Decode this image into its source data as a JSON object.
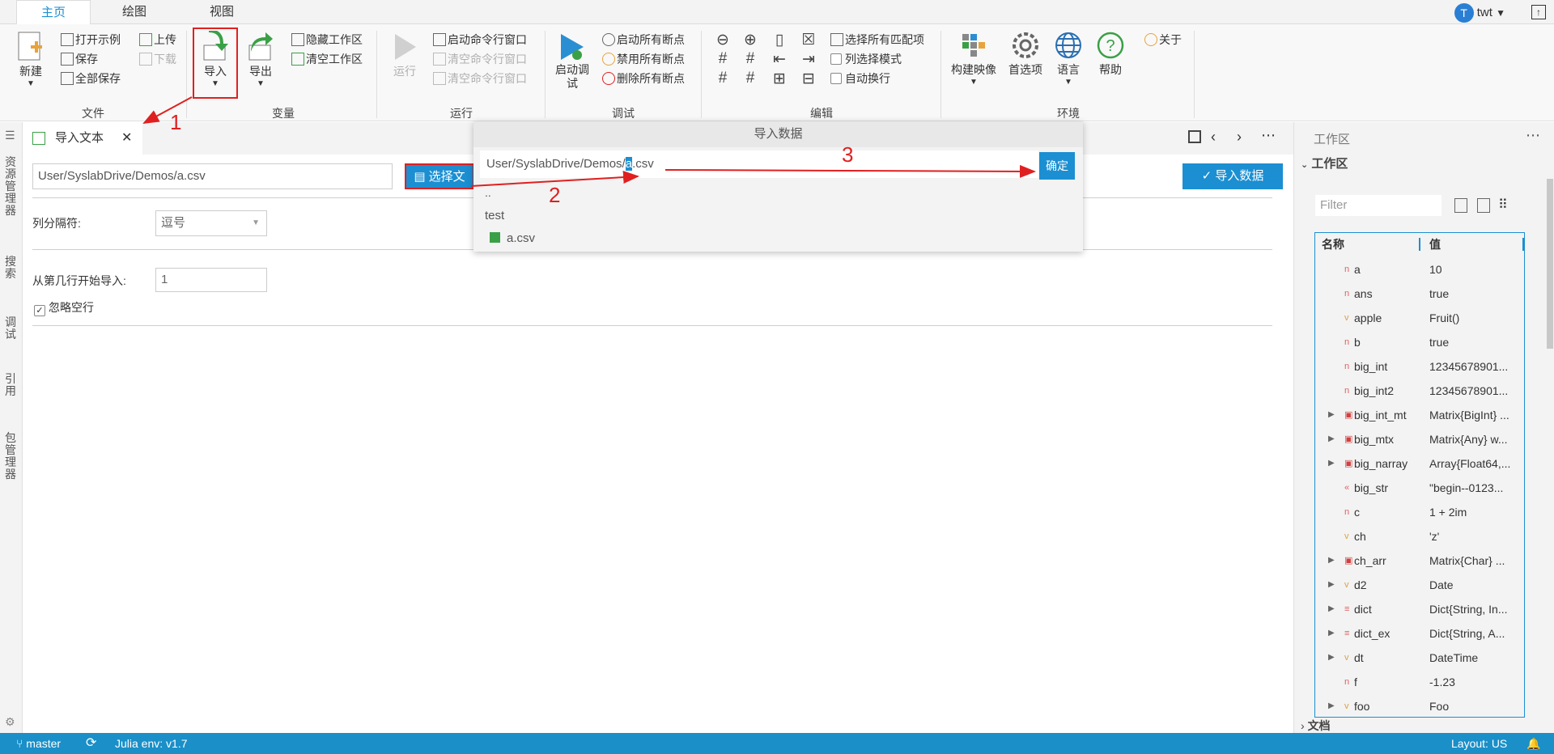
{
  "ribbon_tabs": [
    "主页",
    "绘图",
    "视图"
  ],
  "user": {
    "initial": "T",
    "name": "twt"
  },
  "ribbon": {
    "file": {
      "group": "文件",
      "new": "新建",
      "open_example": "打开示例",
      "save": "保存",
      "save_all": "全部保存",
      "upload": "上传",
      "download": "下载"
    },
    "variable": {
      "group": "变量",
      "import": "导入",
      "export": "导出",
      "hide_workspace": "隐藏工作区",
      "clear_workspace": "清空工作区"
    },
    "run": {
      "group": "运行",
      "run": "运行",
      "start_cmd": "启动命令行窗口",
      "clear_cmd": "清空命令行窗口",
      "clear_cmd2": "清空命令行窗口"
    },
    "debug": {
      "group": "调试",
      "start_debug": "启动调试",
      "start_bp": "启动所有断点",
      "disable_bp": "禁用所有断点",
      "delete_bp": "删除所有断点"
    },
    "edit": {
      "group": "编辑",
      "select_all_match": "选择所有匹配项",
      "column_select": "列选择模式",
      "auto_wrap": "自动换行"
    },
    "env": {
      "group": "环境",
      "build_image": "构建映像",
      "preferences": "首选项",
      "language": "语言",
      "help": "帮助",
      "about": "关于"
    }
  },
  "activity": {
    "explorer": "资源管理器",
    "search": "搜索",
    "debug": "调试",
    "reference": "引用",
    "pkg": "包管理器"
  },
  "editor": {
    "tab_title": "导入文本",
    "path_value": "User/SyslabDrive/Demos/a.csv",
    "select_file_btn": "选择文",
    "import_btn": "导入数据",
    "sep_label": "列分隔符:",
    "sep_value": "逗号",
    "start_row_label": "从第几行开始导入:",
    "start_row_value": "1",
    "ignore_empty": "忽略空行"
  },
  "popup": {
    "title": "导入数据",
    "path_prefix": "User/SyslabDrive/Demos/",
    "path_selected": "a",
    "path_suffix": ".csv",
    "ok": "确定",
    "items": [
      "..",
      "test",
      "a.csv"
    ]
  },
  "workspace": {
    "header": "工作区",
    "section": "工作区",
    "filter_placeholder": "Filter",
    "col_name": "名称",
    "col_value": "值",
    "docs": "文档",
    "rows": [
      {
        "t": "n",
        "name": "a",
        "value": "10",
        "exp": false
      },
      {
        "t": "n",
        "name": "ans",
        "value": "true",
        "exp": false
      },
      {
        "t": "v",
        "name": "apple",
        "value": "Fruit()",
        "exp": false
      },
      {
        "t": "n",
        "name": "b",
        "value": "true",
        "exp": false
      },
      {
        "t": "n",
        "name": "big_int",
        "value": "12345678901...",
        "exp": false
      },
      {
        "t": "n",
        "name": "big_int2",
        "value": "12345678901...",
        "exp": false
      },
      {
        "t": "m",
        "name": "big_int_mt",
        "value": "Matrix{BigInt} ...",
        "exp": true
      },
      {
        "t": "m",
        "name": "big_mtx",
        "value": "Matrix{Any} w...",
        "exp": true
      },
      {
        "t": "m",
        "name": "big_narray",
        "value": "Array{Float64,...",
        "exp": true
      },
      {
        "t": "s",
        "name": "big_str",
        "value": "\"begin--0123...",
        "exp": false
      },
      {
        "t": "n",
        "name": "c",
        "value": "1 + 2im",
        "exp": false
      },
      {
        "t": "v",
        "name": "ch",
        "value": "'z'",
        "exp": false
      },
      {
        "t": "m",
        "name": "ch_arr",
        "value": "Matrix{Char} ...",
        "exp": true
      },
      {
        "t": "v",
        "name": "d2",
        "value": "Date",
        "exp": true
      },
      {
        "t": "d",
        "name": "dict",
        "value": "Dict{String, In...",
        "exp": true
      },
      {
        "t": "d",
        "name": "dict_ex",
        "value": "Dict{String, A...",
        "exp": true
      },
      {
        "t": "v",
        "name": "dt",
        "value": "DateTime",
        "exp": true
      },
      {
        "t": "n",
        "name": "f",
        "value": "-1.23",
        "exp": false
      },
      {
        "t": "v",
        "name": "foo",
        "value": "Foo",
        "exp": true
      }
    ]
  },
  "status": {
    "branch": "master",
    "julia": "Julia env: v1.7",
    "layout": "Layout: US"
  },
  "annotations": [
    "1",
    "2",
    "3"
  ],
  "colors": {
    "accent": "#1b8fd2",
    "status": "#1a8fc8",
    "annotation": "#e02020"
  }
}
